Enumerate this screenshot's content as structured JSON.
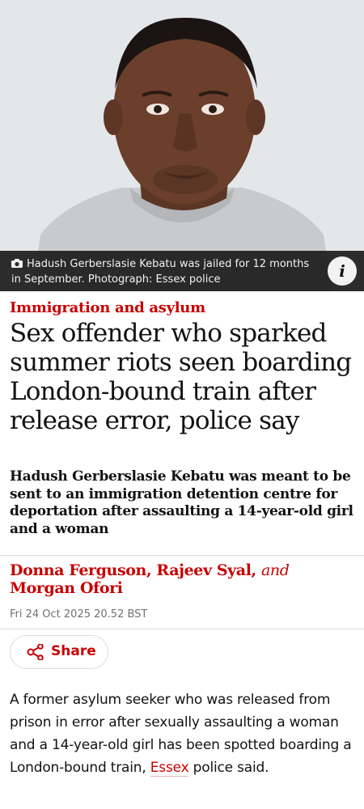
{
  "photo": {
    "caption": "Hadush Gerberslasie Kebatu was jailed for 12 months in September. Photograph: Essex police",
    "camera_icon": "camera-icon",
    "info_label": "i"
  },
  "article": {
    "kicker": "Immigration and asylum",
    "headline": "Sex offender who sparked summer riots seen boarding London-bound train after release error, police say",
    "standfirst": "Hadush Gerberslasie Kebatu was meant to be sent to an immigration detention centre for deportation after assaulting a 14-year-old girl and a woman",
    "byline": {
      "author1": "Donna Ferguson",
      "sep1": ",",
      "author2": "Rajeev Syal",
      "sep2": ",",
      "and": "and",
      "author3": "Morgan Ofori"
    },
    "date": "Fri 24 Oct 2025 20.52 BST",
    "share_label": "Share",
    "body_lead": "A former asylum seeker who was released from prison in error after sexually assaulting a woman and a 14-year-old girl has been spotted boarding a London-bound train, ",
    "body_link": "Essex",
    "body_tail": " police said."
  },
  "colors": {
    "accent": "#c70000",
    "text": "#121212",
    "muted": "#707070",
    "caption_bg": "#121212"
  }
}
